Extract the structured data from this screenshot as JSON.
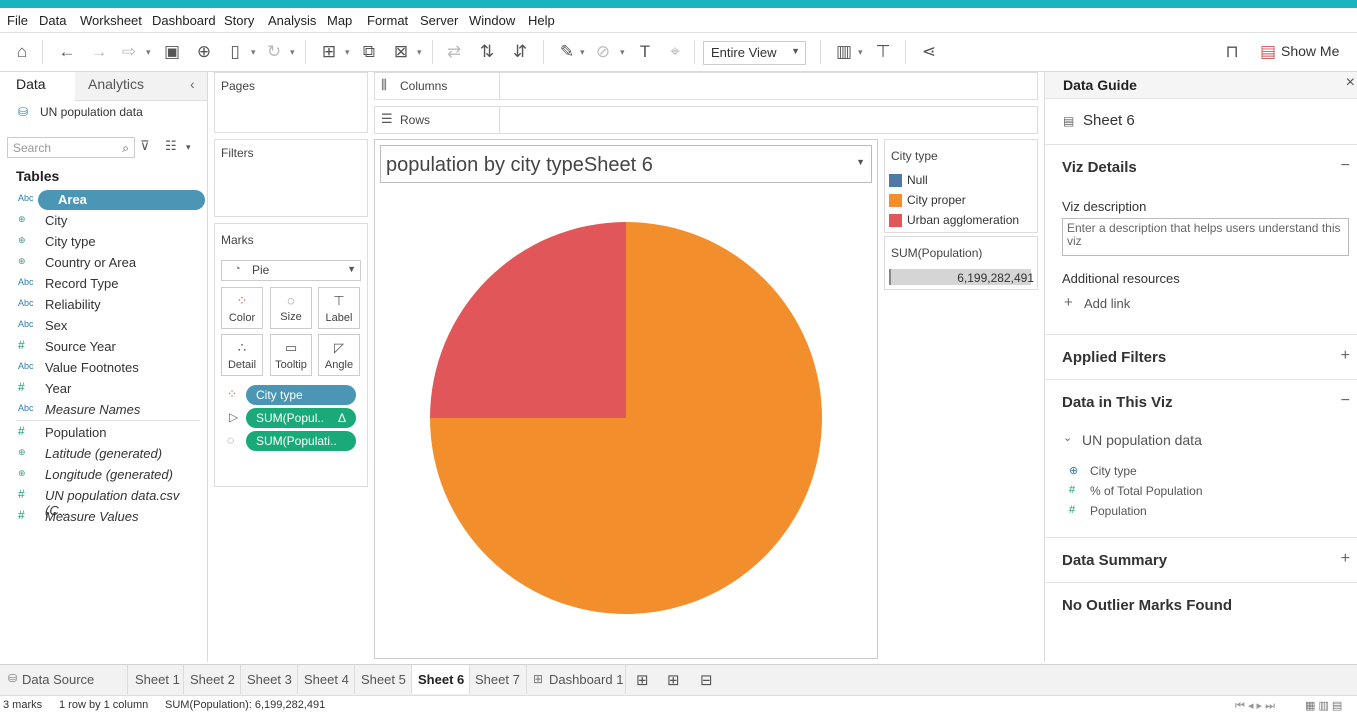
{
  "menu": [
    "File",
    "Data",
    "Worksheet",
    "Dashboard",
    "Story",
    "Analysis",
    "Map",
    "Format",
    "Server",
    "Window",
    "Help"
  ],
  "toolbar": {
    "fit_label": "Entire View",
    "show_me": "Show Me"
  },
  "data_pane": {
    "tabs": [
      "Data",
      "Analytics"
    ],
    "source": "UN population data",
    "search_placeholder": "Search",
    "tables_heading": "Tables",
    "fields": [
      {
        "icon": "Abc",
        "name": "Area",
        "italic": false
      },
      {
        "icon": "globe",
        "name": "City",
        "italic": false
      },
      {
        "icon": "globe",
        "name": "City type",
        "italic": false
      },
      {
        "icon": "globe",
        "name": "Country or Area",
        "italic": false
      },
      {
        "icon": "Abc",
        "name": "Record Type",
        "italic": false
      },
      {
        "icon": "Abc",
        "name": "Reliability",
        "italic": false
      },
      {
        "icon": "Abc",
        "name": "Sex",
        "italic": false
      },
      {
        "icon": "#",
        "name": "Source Year",
        "italic": false
      },
      {
        "icon": "Abc",
        "name": "Value Footnotes",
        "italic": false
      },
      {
        "icon": "#",
        "name": "Year",
        "italic": false
      },
      {
        "icon": "Abc",
        "name": "Measure Names",
        "italic": true
      }
    ],
    "measures": [
      {
        "icon": "#",
        "name": "Population",
        "italic": false
      },
      {
        "icon": "globe",
        "name": "Latitude (generated)",
        "italic": true
      },
      {
        "icon": "globe",
        "name": "Longitude (generated)",
        "italic": true
      },
      {
        "icon": "#",
        "name": "UN population data.csv (C...",
        "italic": true
      },
      {
        "icon": "#",
        "name": "Measure Values",
        "italic": true
      }
    ]
  },
  "shelves": {
    "pages": "Pages",
    "filters": "Filters",
    "marks": "Marks",
    "mark_type": "Pie",
    "mark_buttons": [
      "Color",
      "Size",
      "Label",
      "Detail",
      "Tooltip",
      "Angle"
    ],
    "mark_pills": [
      "City type",
      "SUM(Popul..",
      "SUM(Populati.."
    ],
    "pill_delta": "Δ",
    "columns": "Columns",
    "rows": "Rows"
  },
  "viz": {
    "title": "population  by city typeSheet 6"
  },
  "legend": {
    "title": "City type",
    "items": [
      {
        "name": "Null",
        "color": "#4e79a7"
      },
      {
        "name": "City proper",
        "color": "#f28e2b"
      },
      {
        "name": "Urban agglomeration",
        "color": "#e15759"
      }
    ]
  },
  "size_legend": {
    "title": "SUM(Population)",
    "value": "6,199,282,491"
  },
  "chart_data": {
    "type": "pie",
    "title": "population  by city typeSheet 6",
    "categories": [
      "Null",
      "City proper",
      "Urban agglomeration"
    ],
    "values": [
      0,
      0.75,
      0.25
    ],
    "colors": [
      "#4e79a7",
      "#f28e2b",
      "#e15759"
    ]
  },
  "guide": {
    "title": "Data Guide",
    "sheet": "Sheet 6",
    "viz_details": "Viz Details",
    "viz_description": "Viz description",
    "desc_placeholder": "Enter a description that helps users understand this viz",
    "additional_resources": "Additional resources",
    "add_link": "Add link",
    "applied_filters": "Applied Filters",
    "data_in_viz": "Data in This Viz",
    "source": "UN population data",
    "fields": [
      {
        "icon": "globe",
        "name": "City type"
      },
      {
        "icon": "#",
        "name": "% of Total Population"
      },
      {
        "icon": "#",
        "name": "Population"
      }
    ],
    "data_summary": "Data Summary",
    "no_outliers": "No Outlier Marks Found"
  },
  "tabs": [
    "Data Source",
    "Sheet 1",
    "Sheet 2",
    "Sheet 3",
    "Sheet 4",
    "Sheet 5",
    "Sheet 6",
    "Sheet 7",
    "Dashboard 1"
  ],
  "active_tab": "Sheet 6",
  "status": {
    "marks": "3 marks",
    "rows_cols": "1 row by 1 column",
    "sum": "SUM(Population): 6,199,282,491"
  }
}
